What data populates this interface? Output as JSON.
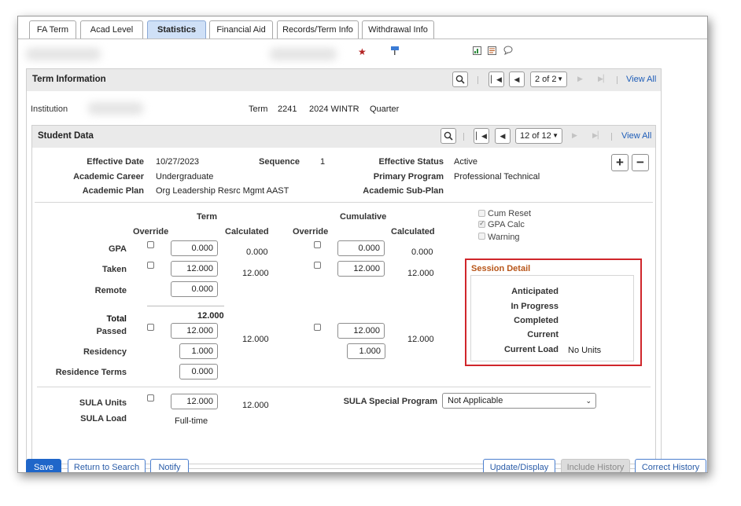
{
  "tabs": [
    {
      "label": "FA Term"
    },
    {
      "label": "Acad Level"
    },
    {
      "label": "Statistics"
    },
    {
      "label": "Financial Aid"
    },
    {
      "label": "Records/Term Info"
    },
    {
      "label": "Withdrawal Info"
    }
  ],
  "term_info": {
    "title": "Term Information",
    "pager": "2 of 2",
    "view_all": "View All",
    "institution_label": "Institution",
    "term_label": "Term",
    "term_code": "2241",
    "term_desc": "2024 WINTR",
    "term_type": "Quarter"
  },
  "student_data": {
    "title": "Student Data",
    "pager": "12 of 12",
    "view_all": "View All",
    "effective_date_label": "Effective Date",
    "effective_date": "10/27/2023",
    "sequence_label": "Sequence",
    "sequence": "1",
    "effective_status_label": "Effective Status",
    "effective_status": "Active",
    "academic_career_label": "Academic Career",
    "academic_career": "Undergraduate",
    "primary_program_label": "Primary Program",
    "primary_program": "Professional Technical",
    "academic_plan_label": "Academic Plan",
    "academic_plan": "Org Leadership Resrc Mgmt AAST",
    "academic_subplan_label": "Academic Sub-Plan"
  },
  "stats": {
    "term_header": "Term",
    "cumulative_header": "Cumulative",
    "override_label": "Override",
    "calculated_label": "Calculated",
    "gpa_label": "GPA",
    "taken_label": "Taken",
    "remote_label": "Remote",
    "total_label": "Total",
    "passed_label": "Passed",
    "residency_label": "Residency",
    "residence_terms_label": "Residence Terms",
    "term_gpa": "0.000",
    "term_gpa_calc": "0.000",
    "term_taken": "12.000",
    "term_taken_calc": "12.000",
    "term_remote": "0.000",
    "term_total": "12.000",
    "term_passed": "12.000",
    "term_passed_calc": "12.000",
    "term_residency": "1.000",
    "term_residence_terms": "0.000",
    "cum_gpa": "0.000",
    "cum_gpa_calc": "0.000",
    "cum_taken": "12.000",
    "cum_taken_calc": "12.000",
    "cum_passed": "12.000",
    "cum_passed_calc": "12.000",
    "cum_residency": "1.000",
    "cum_reset_label": "Cum Reset",
    "gpa_calc_label": "GPA Calc",
    "warning_label": "Warning"
  },
  "session_detail": {
    "title": "Session Detail",
    "anticipated_label": "Anticipated",
    "in_progress_label": "In Progress",
    "completed_label": "Completed",
    "current_label": "Current",
    "current_load_label": "Current Load",
    "current_load": "No Units",
    "highlight_color": "#d0262b"
  },
  "sula": {
    "units_label": "SULA Units",
    "units": "12.000",
    "units_calc": "12.000",
    "load_label": "SULA Load",
    "load": "Full-time",
    "special_program_label": "SULA Special Program",
    "special_program": "Not Applicable"
  },
  "footer": {
    "save": "Save",
    "return_to_search": "Return to Search",
    "notify": "Notify",
    "update_display": "Update/Display",
    "include_history": "Include History",
    "correct_history": "Correct History"
  },
  "colors": {
    "accent": "#1f66c9",
    "active_tab": "#cfe0f7",
    "section_title": "#b8561a"
  }
}
